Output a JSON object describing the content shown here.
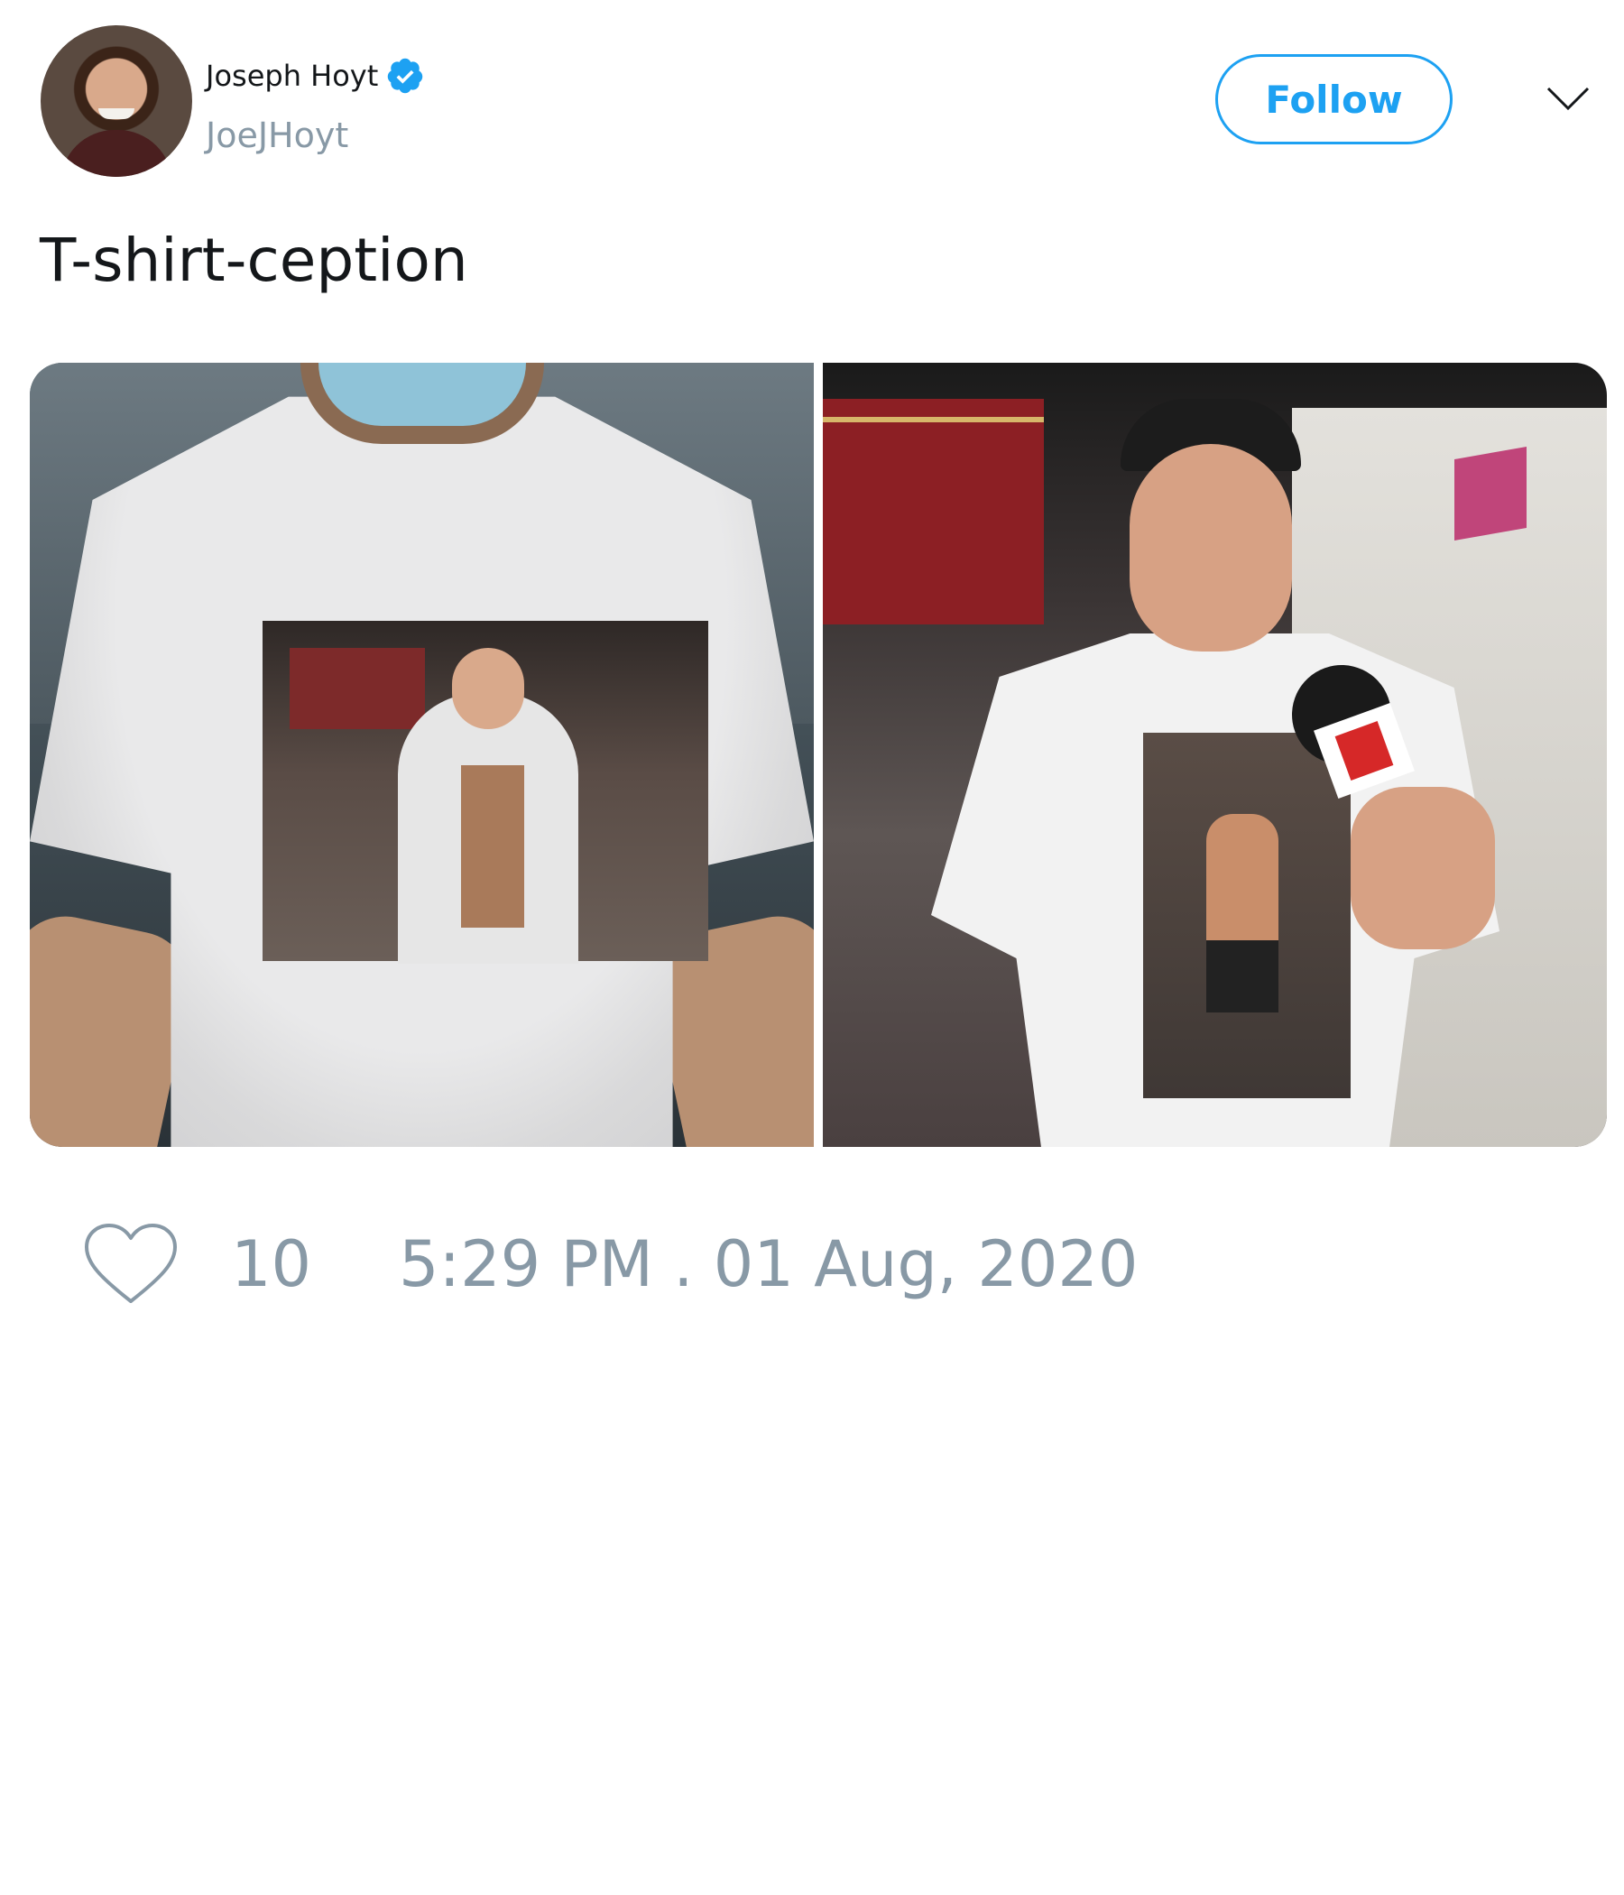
{
  "user": {
    "name": "Joseph Hoyt",
    "handle": "JoeJHoyt",
    "verified": true
  },
  "actions": {
    "follow_label": "Follow"
  },
  "tweet": {
    "text": "T-shirt-ception"
  },
  "footer": {
    "likes": "10",
    "timestamp": "5:29 PM . 01 Aug, 2020"
  },
  "colors": {
    "accent": "#1da1f2",
    "muted": "#8899a6",
    "text": "#14171a"
  },
  "icons": {
    "verified": "verified-badge-icon",
    "menu": "chevron-down-icon",
    "like": "heart-icon"
  }
}
